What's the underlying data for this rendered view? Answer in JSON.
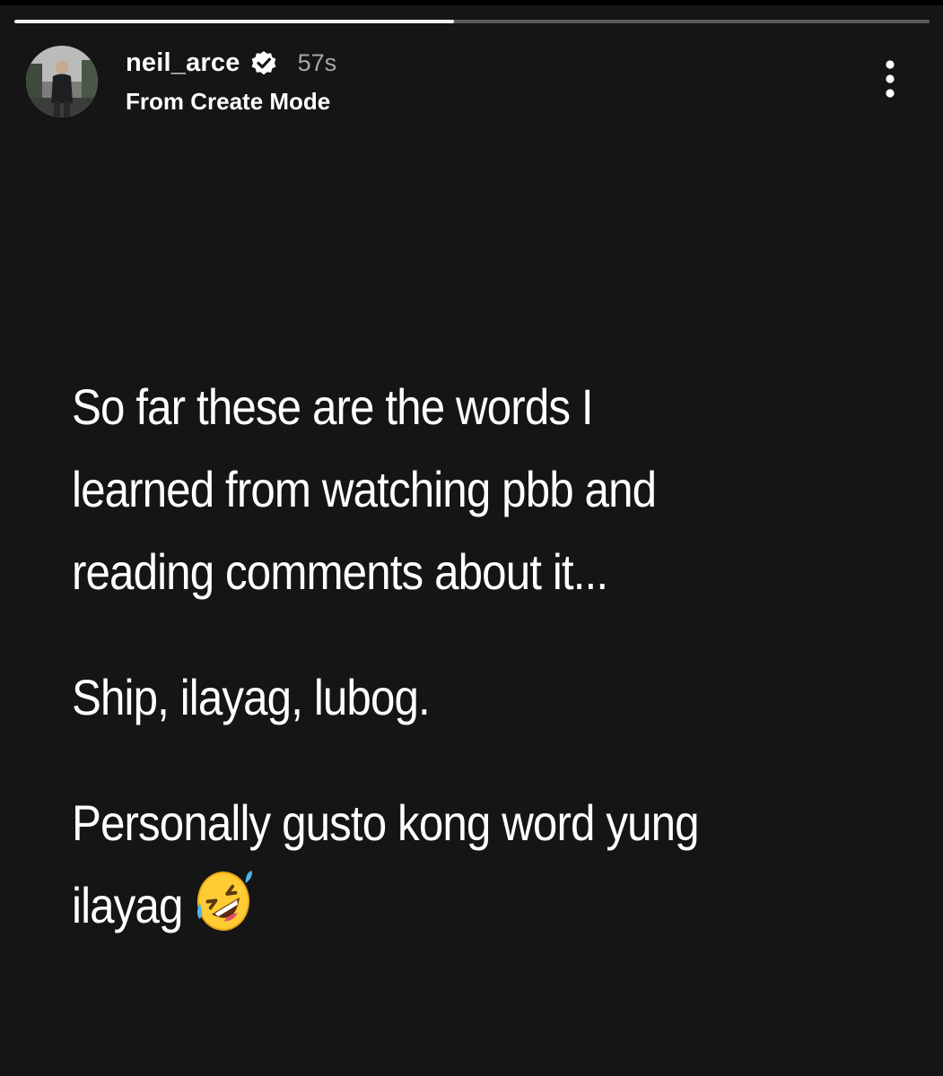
{
  "story": {
    "progress": 0.48,
    "username": "neil_arce",
    "verified": true,
    "timestamp": "57s",
    "subtitle": "From Create Mode",
    "avatar_icon": "profile-photo",
    "more_icon": "more-vertical-icon",
    "paragraphs": [
      "So far these are the words I\nlearned from watching pbb and\nreading comments about it...",
      "Ship, ilayag, lubog.",
      "Personally gusto kong word yung\nilayag"
    ],
    "trailing_emoji": "rolling-on-the-floor-laughing-icon"
  },
  "colors": {
    "background": "#151515",
    "text": "#ffffff",
    "timestamp": "#a8a8a8",
    "progress_fill": "#f2f2f2",
    "progress_track": "#5a5a5a"
  }
}
